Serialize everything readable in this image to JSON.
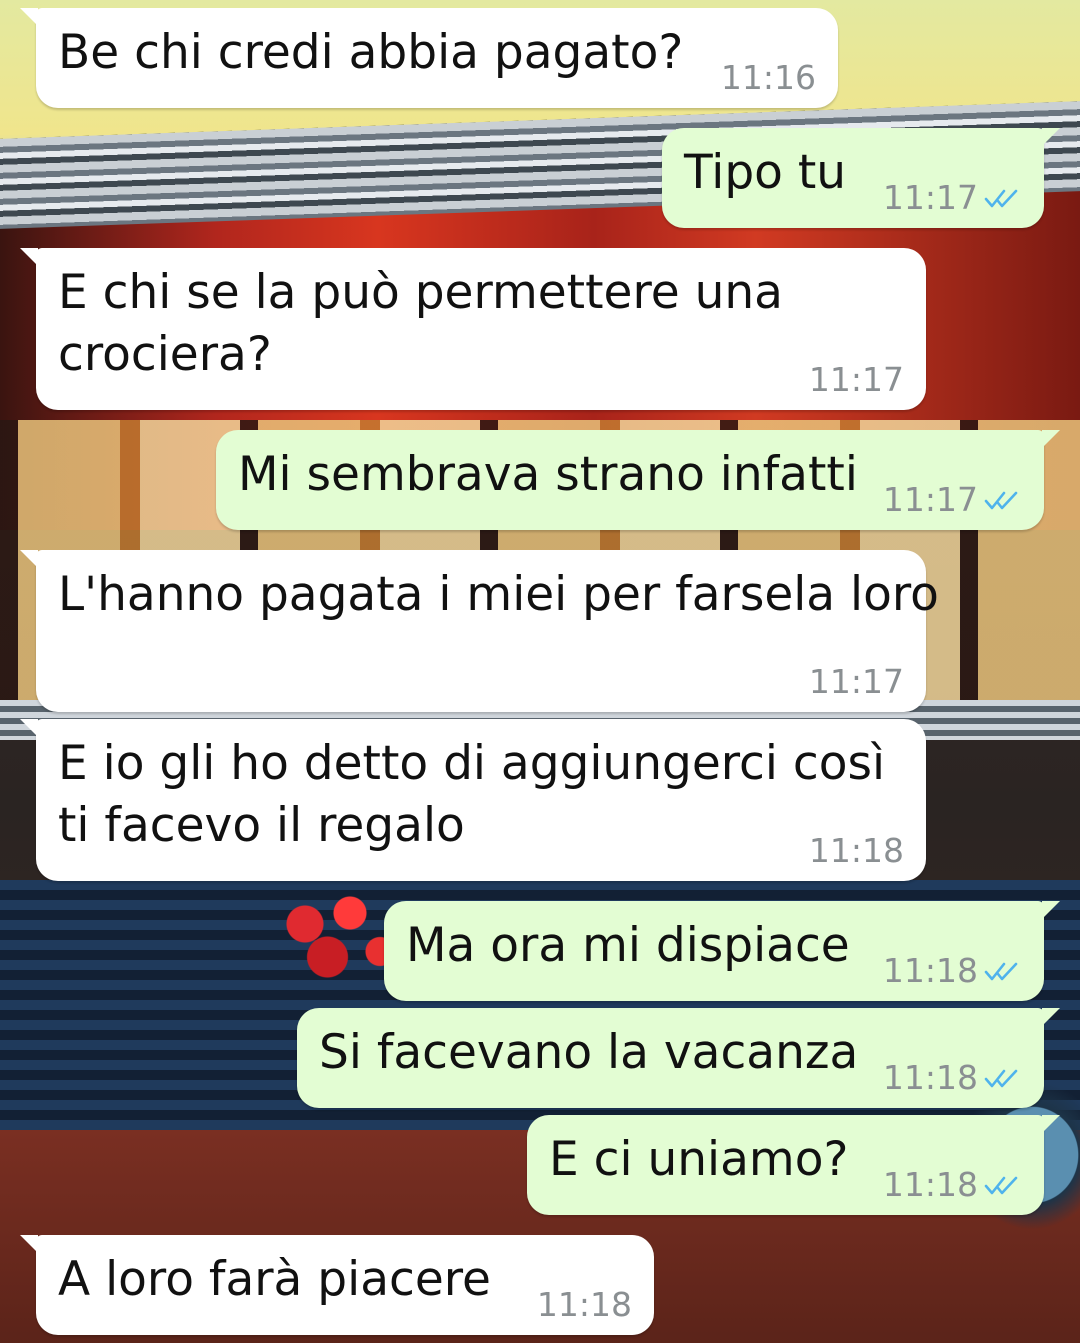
{
  "colors": {
    "incoming_bubble": "#ffffff",
    "outgoing_bubble": "#e3fdd3",
    "read_ticks": "#4fb3ec",
    "timestamp": "#8a8f92"
  },
  "messages": [
    {
      "direction": "in",
      "text": "Be chi credi abbia pagato?",
      "time": "11:16"
    },
    {
      "direction": "out",
      "text": "Tipo tu",
      "time": "11:17",
      "status": "read",
      "status_icon": "double-check-icon"
    },
    {
      "direction": "in",
      "text": "E chi se la può permettere una\ncrociera?",
      "time": "11:17"
    },
    {
      "direction": "out",
      "text": "Mi sembrava strano infatti",
      "time": "11:17",
      "status": "read",
      "status_icon": "double-check-icon"
    },
    {
      "direction": "in",
      "text": "L'hanno pagata i miei per farsela loro",
      "time": "11:17"
    },
    {
      "direction": "in",
      "text": "E io gli ho detto di aggiungerci così\nti facevo il regalo",
      "time": "11:18"
    },
    {
      "direction": "out",
      "text": "Ma ora mi dispiace",
      "time": "11:18",
      "status": "read",
      "status_icon": "double-check-icon"
    },
    {
      "direction": "out",
      "text": "Si facevano la vacanza",
      "time": "11:18",
      "status": "read",
      "status_icon": "double-check-icon"
    },
    {
      "direction": "out",
      "text": "E ci uniamo?",
      "time": "11:18",
      "status": "read",
      "status_icon": "double-check-icon"
    },
    {
      "direction": "in",
      "text": "A loro farà piacere",
      "time": "11:18"
    }
  ]
}
